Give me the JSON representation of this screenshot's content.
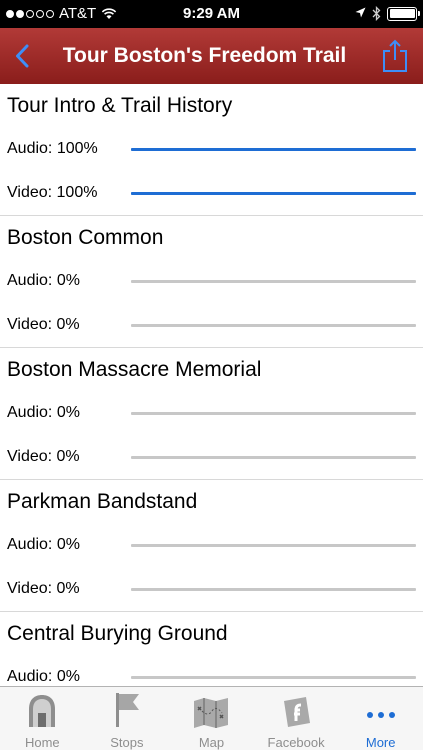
{
  "status_bar": {
    "carrier": "AT&T",
    "time": "9:29 AM",
    "battery_level": 1.0,
    "signal_bars": 2
  },
  "nav": {
    "title": "Tour Boston's Freedom Trail",
    "back_icon": "chevron-left-icon",
    "share_icon": "share-icon"
  },
  "sections": [
    {
      "title": "Tour Intro & Trail History",
      "audio_label": "Audio: 100%",
      "audio_progress": 1.0,
      "video_label": "Video: 100%",
      "video_progress": 1.0
    },
    {
      "title": "Boston Common",
      "audio_label": "Audio: 0%",
      "audio_progress": 0,
      "video_label": "Video: 0%",
      "video_progress": 0
    },
    {
      "title": "Boston Massacre Memorial",
      "audio_label": "Audio: 0%",
      "audio_progress": 0,
      "video_label": "Video: 0%",
      "video_progress": 0
    },
    {
      "title": "Parkman Bandstand",
      "audio_label": "Audio: 0%",
      "audio_progress": 0,
      "video_label": "Video: 0%",
      "video_progress": 0
    },
    {
      "title": "Central Burying Ground",
      "audio_label": "Audio: 0%",
      "audio_progress": 0
    }
  ],
  "tabs": [
    {
      "label": "Home",
      "icon": "home-icon",
      "active": false
    },
    {
      "label": "Stops",
      "icon": "flag-icon",
      "active": false
    },
    {
      "label": "Map",
      "icon": "map-icon",
      "active": false
    },
    {
      "label": "Facebook",
      "icon": "facebook-icon",
      "active": false
    },
    {
      "label": "More",
      "icon": "more-icon",
      "active": true
    }
  ],
  "colors": {
    "nav_bar": "#9e2b28",
    "accent": "#1e6dd4",
    "track": "#c7c7c7"
  }
}
